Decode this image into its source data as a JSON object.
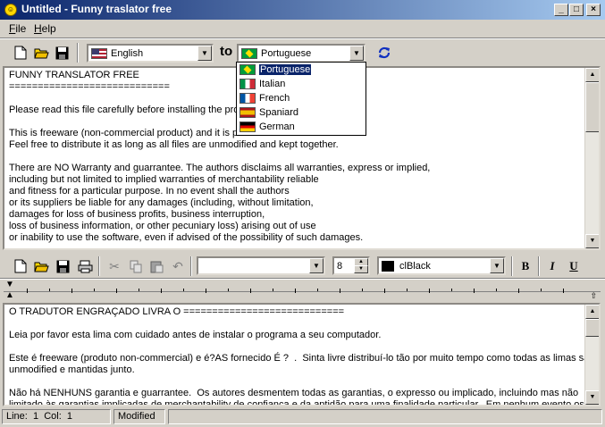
{
  "window": {
    "title": "Untitled - Funny traslator free",
    "icon": "smiley-icon",
    "controls": [
      "minimize",
      "maximize",
      "close"
    ]
  },
  "menu": [
    {
      "label": "File",
      "accel": "F",
      "rest": "ile"
    },
    {
      "label": "Help",
      "accel": "H",
      "rest": "elp"
    }
  ],
  "translate_bar": {
    "source_language": "English",
    "to_label": "to",
    "target_language": "Portuguese",
    "dropdown_options": [
      {
        "label": "Portuguese",
        "flag": "brazil-flag-icon",
        "selected": true
      },
      {
        "label": "Italian",
        "flag": "italy-flag-icon",
        "selected": false
      },
      {
        "label": "French",
        "flag": "france-flag-icon",
        "selected": false
      },
      {
        "label": "Spaniard",
        "flag": "spain-flag-icon",
        "selected": false
      },
      {
        "label": "German",
        "flag": "germany-flag-icon",
        "selected": false
      }
    ]
  },
  "source_text": [
    "FUNNY TRANSLATOR FREE",
    "============================",
    "",
    "Please read this file carefully before installing the progra",
    "",
    "This is freeware (non-commercial product) and it is provi",
    "Feel free to distribute it as long as all files are unmodified and kept together.",
    "",
    "There are NO Warranty and guarrantee. The authors disclaims all warranties, express or implied,",
    "including but not limited to implied warranties of merchantability reliable",
    "and fitness for a particular purpose. In no event shall the authors",
    "or its suppliers be liable for any damages (including, without limitation,",
    "damages for loss of business profits, business interruption,",
    "loss of business information, or other pecuniary loss) arising out of use",
    "or inability to use the software, even if advised of the possibility of such damages."
  ],
  "format_bar": {
    "font_name": "",
    "font_size": "8",
    "color_name": "clBlack",
    "color_swatch": "#000000",
    "bold_label": "B",
    "italic_label": "I",
    "underline_label": "U"
  },
  "translated_text": [
    "O TRADUTOR ENGRAÇADO LIVRA O ============================",
    "",
    "Leia por favor esta lima com cuidado antes de instalar o programa a seu computador.",
    "",
    "Este é freeware (produto non-commercial) e é?AS fornecido É ?  .  Sinta livre distribuí-lo tão por muito tempo como todas as limas são",
    "unmodified e mantidas junto.",
    "",
    "Não há NENHUNS garantia e guarrantee.  Os autores desmentem todas as garantias, o expresso ou implicado, incluindo mas não",
    "limitado às garantias implicadas de merchantability de confiança e da aptidão para uma finalidade particular.  Em nenhum evento os"
  ],
  "status_bar": {
    "line_label": "Line:",
    "line_value": "1",
    "col_label": "Col:",
    "col_value": "1",
    "modified": "Modified"
  }
}
